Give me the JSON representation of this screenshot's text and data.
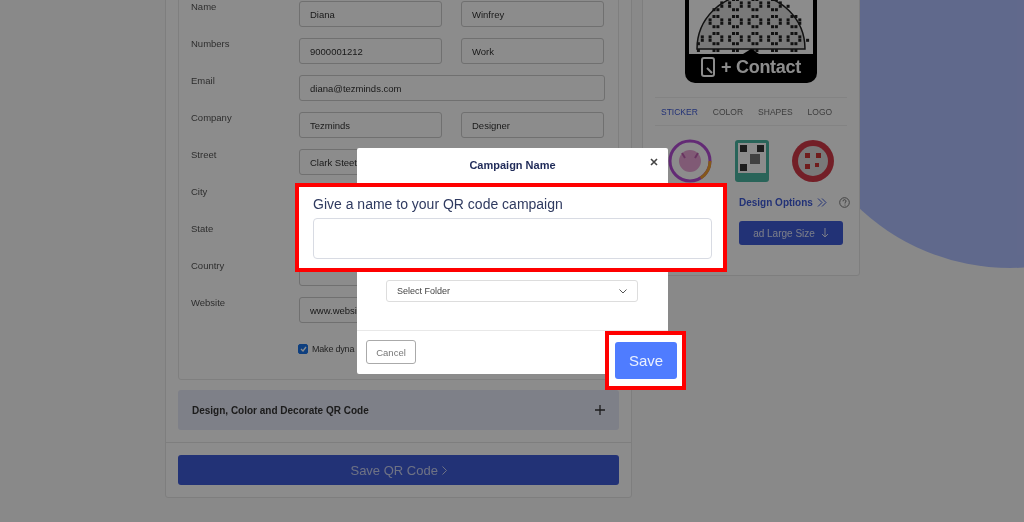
{
  "form": {
    "rows": [
      {
        "label": "Name",
        "kind": "pair",
        "fields": [
          "Diana",
          "Winfrey"
        ]
      },
      {
        "label": "Numbers",
        "kind": "pair",
        "fields": [
          "9000001212",
          "Work"
        ]
      },
      {
        "label": "Email",
        "kind": "wide",
        "fields": [
          "diana@tezminds.com"
        ]
      },
      {
        "label": "Company",
        "kind": "pair",
        "fields": [
          "Tezminds",
          "Designer"
        ]
      },
      {
        "label": "Street",
        "kind": "pair",
        "fields": [
          "Clark Steet"
        ]
      },
      {
        "label": "City",
        "kind": "label_only",
        "fields": []
      },
      {
        "label": "State",
        "kind": "label_only",
        "fields": []
      },
      {
        "label": "Country",
        "kind": "pair",
        "fields": []
      },
      {
        "label": "Website",
        "kind": "wide",
        "fields": [
          "www.websi"
        ]
      }
    ],
    "checkbox": {
      "label": "Make dyna",
      "checked": true
    }
  },
  "accordion": {
    "title": "Design, Color and Decorate QR Code",
    "expanded": false
  },
  "save_button": "Save QR Code",
  "preview": {
    "sticker_caption": "+ Contact",
    "tabs": [
      {
        "label": "STICKER",
        "selected": true
      },
      {
        "label": "COLOR",
        "selected": false
      },
      {
        "label": "SHAPES",
        "selected": false
      },
      {
        "label": "LOGO",
        "selected": false
      }
    ],
    "stickers": [
      {
        "kind": "ring"
      },
      {
        "kind": "card"
      },
      {
        "kind": "seal"
      }
    ],
    "design_options": "Design Options",
    "download_button": "ad Large Size"
  },
  "modal": {
    "title": "Campaign Name",
    "prompt": "Give a name to your QR code campaign",
    "folder_select": "Select Folder",
    "cancel": "Cancel",
    "save": "Save"
  }
}
